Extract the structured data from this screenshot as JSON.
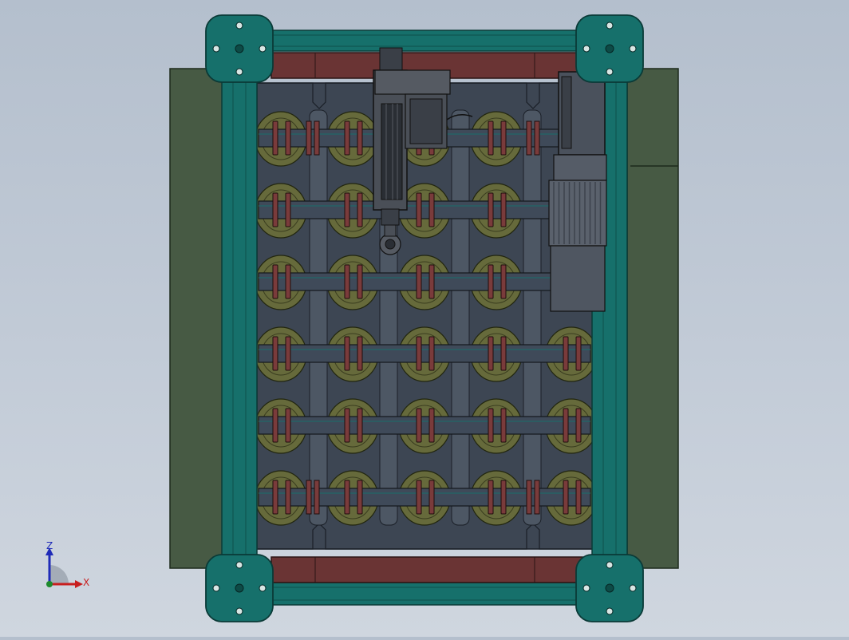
{
  "viewport": {
    "background_top": "#b4bfcd",
    "background_bottom": "#cfd6df"
  },
  "model": {
    "frame_color": "#16706b",
    "frame_dark": "#0f4f4b",
    "side_panel_color": "#475a44",
    "roller_color": "#3f4a59",
    "wheel_color": "#666a3b",
    "flange_color": "#7a3b3b",
    "end_plate_color": "#6a3434",
    "base_plate_color": "#3d4653",
    "motor_color": "#4a515c",
    "roller_rows": 6,
    "wheel_columns": 5
  },
  "triad": {
    "z_label": "Z",
    "x_label": "X",
    "z_color": "#1f2bb8",
    "x_color": "#c81e1e",
    "y_color": "#1e8a2e"
  }
}
